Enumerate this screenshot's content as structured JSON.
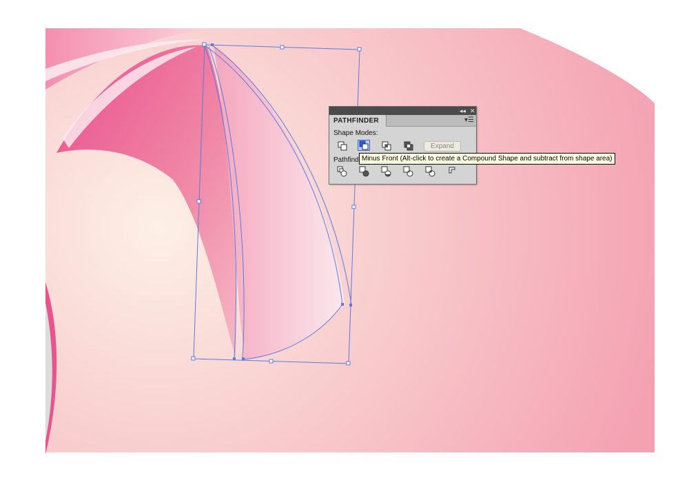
{
  "panel": {
    "title": "PATHFINDER",
    "collapse_icon": "collapse-arrows-icon",
    "close_icon": "close-icon",
    "menu_icon": "panel-menu-icon",
    "shape_modes_label": "Shape Modes:",
    "pathfinders_label": "Pathfind",
    "expand_label": "Expand",
    "shape_mode_buttons": [
      "unite",
      "minus-front",
      "intersect",
      "exclude"
    ],
    "pathfinder_buttons": [
      "divide",
      "trim",
      "merge",
      "crop",
      "outline",
      "minus-back"
    ]
  },
  "tooltip": {
    "text": "Minus Front (Alt-click to create a Compound Shape and subtract from shape area)"
  },
  "colors": {
    "background_pink": "#f7c9cf",
    "petal_dark": "#e8548c",
    "selection_blue": "#5b79e0",
    "panel_gray": "#d4d4d4",
    "tooltip_yellow": "#ffffe1"
  }
}
